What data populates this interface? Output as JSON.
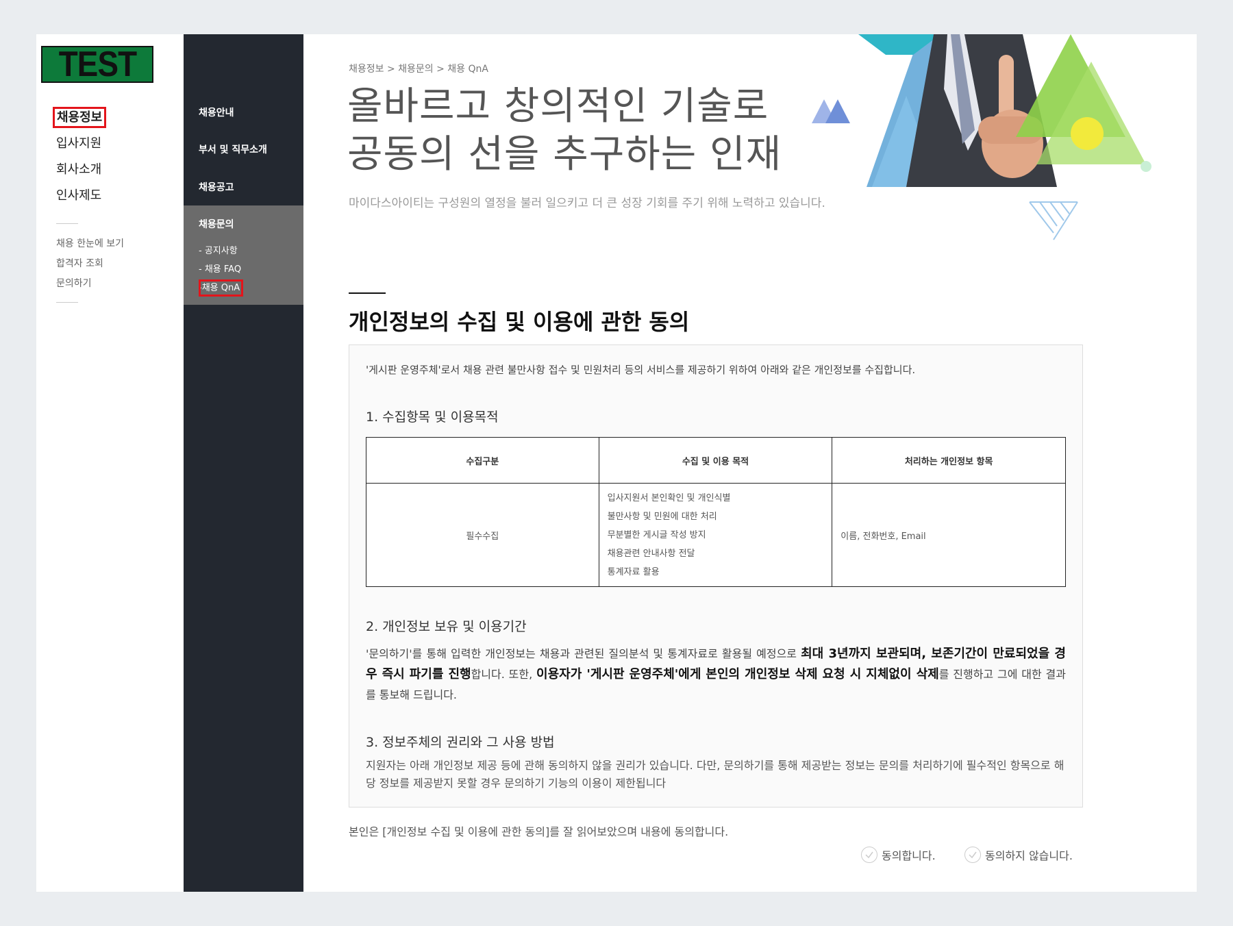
{
  "logo": {
    "text": "TEST"
  },
  "main_nav": [
    "채용정보",
    "입사지원",
    "회사소개",
    "인사제도"
  ],
  "sub_links": [
    "채용 한눈에 보기",
    "합격자 조회",
    "문의하기"
  ],
  "secondary_nav": {
    "items": [
      "채용안내",
      "부서 및 직무소개",
      "채용공고"
    ],
    "active_group": {
      "title": "채용문의",
      "subs": [
        "- 공지사항",
        "- 채용 FAQ",
        "채용 QnA"
      ],
      "active_sub_prefix": "-"
    }
  },
  "breadcrumb": "채용정보 > 채용문의 > 채용 QnA",
  "hero": {
    "line1": "올바르고 창의적인 기술로",
    "line2": "공동의 선을 추구하는 인재",
    "subtitle": "마이다스아이티는 구성원의 열정을 불러 일으키고 더 큰 성장 기회를 주기 위해 노력하고 있습니다."
  },
  "section_title": "개인정보의 수집 및 이용에 관한 동의",
  "policy": {
    "intro": "'게시판 운영주체'로서 채용 관련 불만사항 접수 및 민원처리 등의 서비스를 제공하기 위하여 아래와 같은 개인정보를 수집합니다.",
    "h1": "1. 수집항목 및 이용목적",
    "table": {
      "headers": [
        "수집구분",
        "수집 및 이용 목적",
        "처리하는 개인정보 항목"
      ],
      "row": {
        "category": "필수수집",
        "purposes": [
          "입사지원서 본인확인 및 개인식별",
          "불만사항 및 민원에 대한 처리",
          "무분별한 게시글 작성 방지",
          "채용관련 안내사항 전달",
          "통계자료 활용"
        ],
        "items": "이름, 전화번호, Email"
      }
    },
    "h2": "2. 개인정보 보유 및 이용기간",
    "p2": {
      "a": "'문의하기'를 통해 입력한 개인정보는 채용과 관련된 질의분석 및 통계자료로 활용될 예정으로 ",
      "b": "최대 3년까지 보관되며, 보존기간이 만료되었을 경우 즉시 파기를 진행",
      "c": "합니다. 또한, ",
      "d": "이용자가 '게시판 운영주체'에게 본인의 개인정보 삭제 요청 시 지체없이 삭제",
      "e": "를 진행하고 그에 대한 결과를 통보해 드립니다."
    },
    "h3": "3. 정보주체의 권리와 그 사용 방법",
    "p3": "지원자는 아래 개인정보 제공 등에 관해 동의하지 않을 권리가 있습니다. 다만, 문의하기를 통해 제공받는 정보는 문의를 처리하기에 필수적인 항목으로 해당 정보를 제공받지 못할 경우 문의하기 기능의 이용이 제한됩니다"
  },
  "agree": {
    "text": "본인은 [개인정보 수집 및 이용에 관한 동의]를 잘 읽어보았으며 내용에 동의합니다.",
    "yes": "동의합니다.",
    "no": "동의하지 않습니다."
  },
  "colors": {
    "dark_sidebar": "#232830",
    "active_block": "#6b6b6b",
    "highlight": "#e3141b",
    "logo_bg": "#0d7a3a"
  }
}
